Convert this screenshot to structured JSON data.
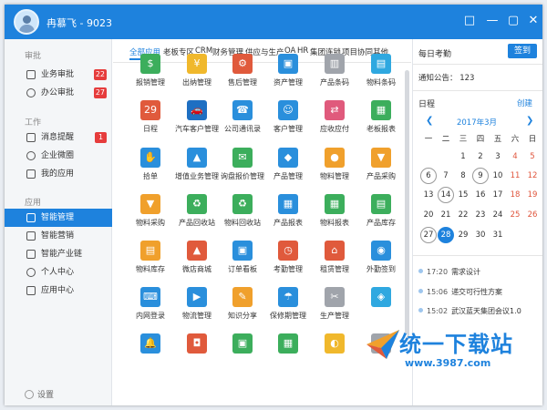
{
  "window": {
    "title": "冉慕飞 - 9023",
    "controls": [
      "□",
      "—",
      "▢",
      "✕"
    ]
  },
  "sidebar": {
    "sections": [
      {
        "label": "审批",
        "items": [
          {
            "label": "业务审批",
            "badge": "22"
          },
          {
            "label": "办公审批",
            "badge": "27"
          }
        ]
      },
      {
        "label": "工作",
        "items": [
          {
            "label": "消息提醒",
            "badge": "1"
          },
          {
            "label": "企业微圈",
            "badge": ""
          },
          {
            "label": "我的应用",
            "badge": ""
          }
        ]
      },
      {
        "label": "应用",
        "items": [
          {
            "label": "智能管理",
            "badge": ""
          },
          {
            "label": "智能营销",
            "badge": ""
          },
          {
            "label": "智能产业链",
            "badge": ""
          },
          {
            "label": "个人中心",
            "badge": ""
          },
          {
            "label": "应用中心",
            "badge": ""
          }
        ]
      }
    ],
    "settings_label": "设置"
  },
  "tabs": [
    "全部应用",
    "老板专区",
    "CRM",
    "财务管理",
    "供应与生产",
    "OA",
    "HR",
    "集团连锁",
    "项目协同",
    "其他"
  ],
  "apps": [
    {
      "label": "报销管理",
      "icon": "reimburse-icon",
      "color": "#3cae5c",
      "glyph": "$"
    },
    {
      "label": "出纳管理",
      "icon": "cashier-icon",
      "color": "#f0b82c",
      "glyph": "¥"
    },
    {
      "label": "售后管理",
      "icon": "aftersale-icon",
      "color": "#e05a3c",
      "glyph": "⚙"
    },
    {
      "label": "资产管理",
      "icon": "asset-icon",
      "color": "#2a8fdc",
      "glyph": "▣"
    },
    {
      "label": "产品条码",
      "icon": "barcode-icon",
      "color": "#a0a4ab",
      "glyph": "▥"
    },
    {
      "label": "物料条码",
      "icon": "material-barcode-icon",
      "color": "#2fa8e0",
      "glyph": "▤"
    },
    {
      "label": "日程",
      "icon": "calendar-icon",
      "color": "#e05a3c",
      "glyph": "29"
    },
    {
      "label": "汽车客户管理",
      "icon": "car-icon",
      "color": "#1e6fc2",
      "glyph": "🚗"
    },
    {
      "label": "公司通讯录",
      "icon": "contacts-icon",
      "color": "#2a8fdc",
      "glyph": "☎"
    },
    {
      "label": "客户管理",
      "icon": "customer-icon",
      "color": "#2a8fdc",
      "glyph": "☺"
    },
    {
      "label": "应收应付",
      "icon": "receivable-icon",
      "color": "#e05a7c",
      "glyph": "⇄"
    },
    {
      "label": "老板报表",
      "icon": "boss-report-icon",
      "color": "#3cae5c",
      "glyph": "▦"
    },
    {
      "label": "拾单",
      "icon": "order-pick-icon",
      "color": "#2a8fdc",
      "glyph": "✋"
    },
    {
      "label": "增值业务管理",
      "icon": "value-added-icon",
      "color": "#2a8fdc",
      "glyph": "▲"
    },
    {
      "label": "询盘报价管理",
      "icon": "inquiry-icon",
      "color": "#3cae5c",
      "glyph": "✉"
    },
    {
      "label": "产品管理",
      "icon": "product-icon",
      "color": "#2a8fdc",
      "glyph": "◆"
    },
    {
      "label": "物料管理",
      "icon": "material-icon",
      "color": "#f0a02c",
      "glyph": "●"
    },
    {
      "label": "产品采购",
      "icon": "purchase-icon",
      "color": "#f0a02c",
      "glyph": "▼"
    },
    {
      "label": "物料采购",
      "icon": "material-purchase-icon",
      "color": "#f0a02c",
      "glyph": "▼"
    },
    {
      "label": "产品回收站",
      "icon": "product-recycle-icon",
      "color": "#3cae5c",
      "glyph": "♻"
    },
    {
      "label": "物料回收站",
      "icon": "material-recycle-icon",
      "color": "#3cae5c",
      "glyph": "♻"
    },
    {
      "label": "产品报表",
      "icon": "product-report-icon",
      "color": "#2a8fdc",
      "glyph": "▦"
    },
    {
      "label": "物料报表",
      "icon": "material-report-icon",
      "color": "#3cae5c",
      "glyph": "▦"
    },
    {
      "label": "产品库存",
      "icon": "product-stock-icon",
      "color": "#3cae5c",
      "glyph": "▤"
    },
    {
      "label": "物料库存",
      "icon": "material-stock-icon",
      "color": "#f0a02c",
      "glyph": "▤"
    },
    {
      "label": "微店商城",
      "icon": "shop-icon",
      "color": "#e05a3c",
      "glyph": "▲"
    },
    {
      "label": "订单看板",
      "icon": "order-board-icon",
      "color": "#2a8fdc",
      "glyph": "▣"
    },
    {
      "label": "考勤管理",
      "icon": "attendance-icon",
      "color": "#e05a3c",
      "glyph": "◷"
    },
    {
      "label": "租赁管理",
      "icon": "lease-icon",
      "color": "#e05a3c",
      "glyph": "⌂"
    },
    {
      "label": "外勤签到",
      "icon": "checkin-icon",
      "color": "#2a8fdc",
      "glyph": "◉"
    },
    {
      "label": "内网登录",
      "icon": "intranet-icon",
      "color": "#2a8fdc",
      "glyph": "⌨"
    },
    {
      "label": "物流管理",
      "icon": "logistics-icon",
      "color": "#2a8fdc",
      "glyph": "▶"
    },
    {
      "label": "知识分享",
      "icon": "knowledge-icon",
      "color": "#f0a02c",
      "glyph": "✎"
    },
    {
      "label": "保修期管理",
      "icon": "warranty-icon",
      "color": "#2a8fdc",
      "glyph": "☂"
    },
    {
      "label": "生产管理",
      "icon": "production-icon",
      "color": "#a0a4ab",
      "glyph": "✂"
    },
    {
      "label": "",
      "icon": "app-icon",
      "color": "#2fa8e0",
      "glyph": "◈"
    },
    {
      "label": "",
      "icon": "app-icon",
      "color": "#2a8fdc",
      "glyph": "🔔"
    },
    {
      "label": "",
      "icon": "app-icon",
      "color": "#e05a3c",
      "glyph": "◘"
    },
    {
      "label": "",
      "icon": "app-icon",
      "color": "#3cae5c",
      "glyph": "▣"
    },
    {
      "label": "",
      "icon": "app-icon",
      "color": "#3cae5c",
      "glyph": "▦"
    },
    {
      "label": "",
      "icon": "app-icon",
      "color": "#f0b82c",
      "glyph": "◐"
    },
    {
      "label": "",
      "icon": "app-icon",
      "color": "#a0a4ab",
      "glyph": "▥"
    }
  ],
  "attendance": {
    "title": "每日考勤",
    "button": "签到",
    "notice": "通知公告： 123"
  },
  "schedule": {
    "title": "日程",
    "create": "创建"
  },
  "calendar": {
    "title": "2017年3月",
    "weekdays": [
      "一",
      "二",
      "三",
      "四",
      "五",
      "六",
      "日"
    ],
    "rows": [
      [
        "",
        "",
        "1",
        "2",
        "3",
        "4",
        "5"
      ],
      [
        "6",
        "7",
        "8",
        "9",
        "10",
        "11",
        "12"
      ],
      [
        "13",
        "14",
        "15",
        "16",
        "17",
        "18",
        "19"
      ],
      [
        "20",
        "21",
        "22",
        "23",
        "24",
        "25",
        "26"
      ],
      [
        "27",
        "28",
        "29",
        "30",
        "31",
        "",
        ""
      ]
    ],
    "ringed": [
      "6",
      "9",
      "14",
      "27"
    ],
    "today": "28"
  },
  "events": [
    {
      "time": "17:20",
      "title": "需求设计"
    },
    {
      "time": "15:06",
      "title": "递交可行性方案"
    },
    {
      "time": "15:02",
      "title": "武汉蓝天集团会议1.0"
    }
  ],
  "watermark": {
    "text": "统一下载站",
    "url": "www.3987.com"
  },
  "colors": {
    "accent": "#1e82dd",
    "badge": "#e63c3c",
    "weekend": "#e0553c"
  }
}
